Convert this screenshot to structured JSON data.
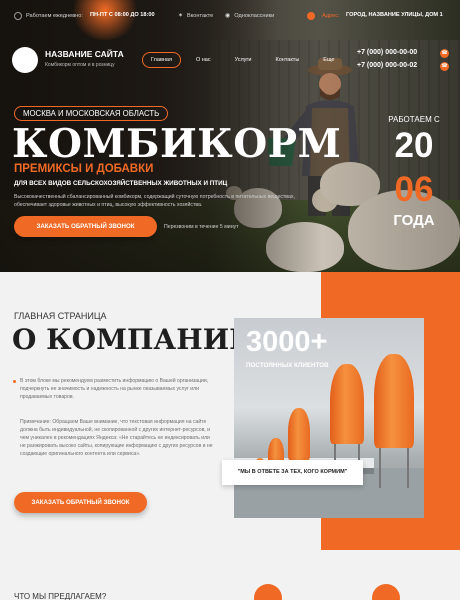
{
  "topbar": {
    "hours_label": "Работаем ежедневно:",
    "hours_value": "ПН-ПТ С 08:00 ДО 18:00",
    "social_1": "Вконтакте",
    "social_2": "Одноклассники",
    "address_label": "Адрес:",
    "address_value": "ГОРОД, НАЗВАНИЕ УЛИЦЫ, ДОМ 1"
  },
  "header": {
    "site_name": "НАЗВАНИЕ САЙТА",
    "site_tagline": "Комбикорм оптом и в розницу",
    "nav": [
      "Главная",
      "О нас",
      "Услуги",
      "Контакты",
      "Еще"
    ],
    "phones": [
      "+7 (000) 000-00-00",
      "+7 (000) 000-00-02"
    ]
  },
  "hero": {
    "region": "МОСКВА И МОСКОВСКАЯ ОБЛАСТЬ",
    "title": "КОМБИКОРМ",
    "subtitle": "ПРЕМИКСЫ И ДОБАВКИ",
    "tagline": "ДЛЯ ВСЕХ ВИДОВ СЕЛЬСКОХОЗЯЙСТВЕННЫХ ЖИВОТНЫХ И ПТИЦ",
    "description": "Высококачественный сбалансированный комбикорм, содержащий суточную потребность в питательных веществах, обеспечивает здоровье животных и птиц, высокую эффективность хозяйства.",
    "cta": "ЗАКАЗАТЬ ОБРАТНЫЙ ЗВОНОК",
    "callback_note": "Перезвоним в течение 5 минут",
    "work_label": "РАБОТАЕМ С",
    "work_year_1": "20",
    "work_year_2": "06",
    "work_years_word": "ГОДА"
  },
  "about": {
    "breadcrumb": "ГЛАВНАЯ СТРАНИЦА",
    "title": "О КОМПАНИИ",
    "paragraph_1": "В этом блоке мы рекомендуем разместить информацию о Вашей организации, подчеркнуть ее значимость и надежность на рынке оказываемых услуг или продаваемых товаров.",
    "paragraph_2": "Примечание: Обращаем Ваше внимание, что текстовая информация на сайте должна быть индивидуальной, не скопированной с других интернет-ресурсов, и чем уникален в рекомендациях Яндекса: «Не старайтесь не индексировать или не ранжировать высоко сайты, копирующие информацию с других ресурсов и не создающие оригинального контента или сервиса».",
    "cta": "ЗАКАЗАТЬ ОБРАТНЫЙ ЗВОНОК",
    "stat_value": "3000+",
    "stat_label": "ПОСТОЯННЫХ КЛИЕНТОВ",
    "quote": "\"МЫ В ОТВЕТЕ ЗА ТЕХ, КОГО КОРМИМ\""
  },
  "offer": {
    "title": "ЧТО МЫ ПРЕДЛАГАЕМ?"
  },
  "colors": {
    "accent": "#f06a25",
    "dark": "#1f1f1f",
    "background": "#f2f2f2"
  },
  "icons": [
    "clock-icon",
    "vk-icon",
    "ok-icon",
    "location-icon",
    "phone-icon"
  ]
}
